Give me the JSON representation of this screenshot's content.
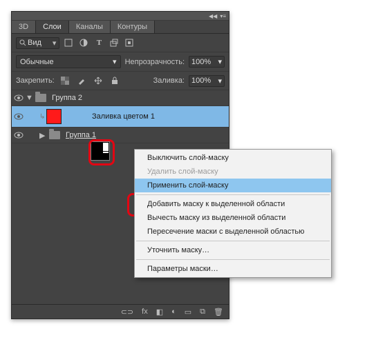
{
  "tabs": {
    "t0": "3D",
    "t1": "Слои",
    "t2": "Каналы",
    "t3": "Контуры"
  },
  "row1": {
    "kind": "Вид"
  },
  "row2": {
    "blend": "Обычные",
    "opacity_label": "Непрозрачность:",
    "opacity": "100%"
  },
  "row3": {
    "lock_label": "Закрепить:",
    "fill_label": "Заливка:",
    "fill": "100%"
  },
  "layers": {
    "g2": "Группа 2",
    "fill1": "Заливка цветом 1",
    "g1": "Группа 1"
  },
  "ctx": {
    "m0": "Выключить слой-маску",
    "m1": "Удалить слой-маску",
    "m2": "Применить слой-маску",
    "m3": "Добавить маску к выделенной области",
    "m4": "Вычесть маску из выделенной области",
    "m5": "Пересечение маски с выделенной областью",
    "m6": "Уточнить маску…",
    "m7": "Параметры маски…"
  },
  "bottom": {
    "link": "⊂⊃",
    "fx": "fx",
    "mask": "◧",
    "adj": "◐",
    "group": "▭",
    "new": "⧉",
    "trash": "🗑"
  }
}
